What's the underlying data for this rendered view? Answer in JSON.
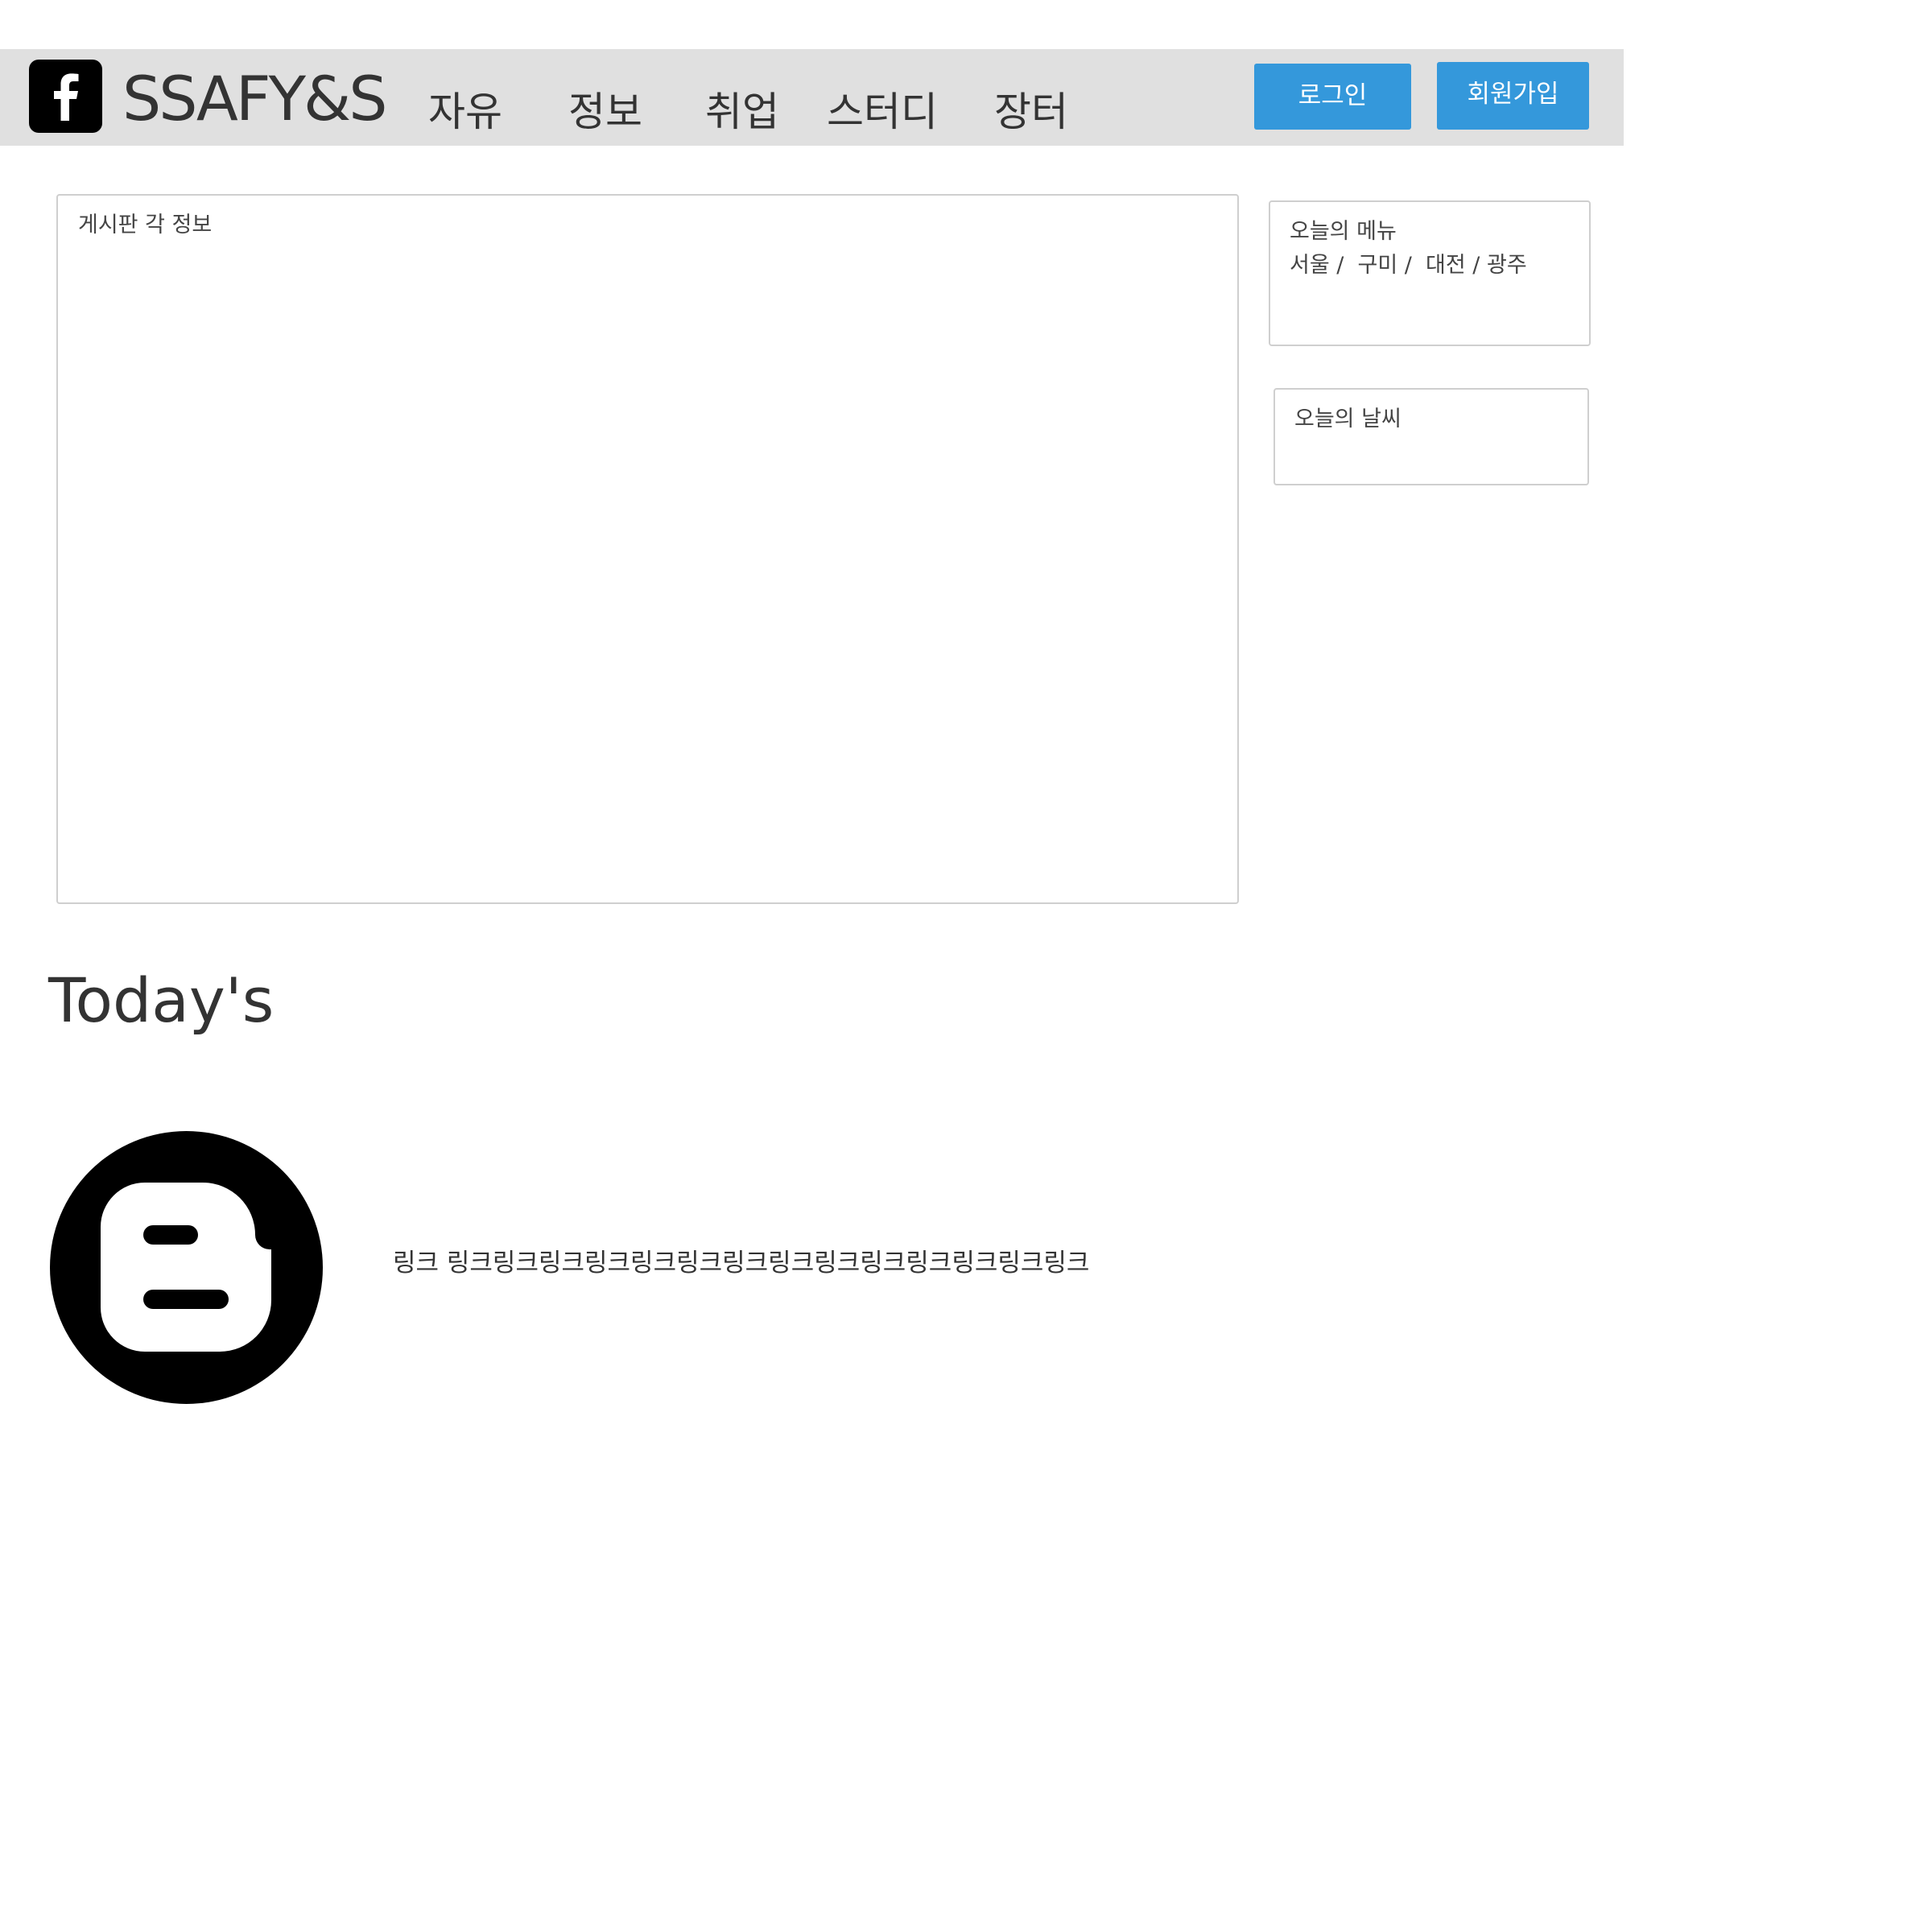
{
  "header": {
    "brand": "SSAFY&S",
    "nav": [
      "자유",
      "정보",
      "취업",
      "스터디",
      "장터"
    ],
    "login_label": "로그인",
    "signup_label": "회원가입",
    "background_color": "#e0e0e0",
    "button_color": "#3498db",
    "logo_icon": "facebook-icon"
  },
  "board": {
    "title": "게시판 각 정보"
  },
  "sidebar": {
    "menu": {
      "title": "오늘의 메뉴",
      "regions": "서울 /  구미 /  대전 / 광주"
    },
    "weather": {
      "title": "오늘의 날씨"
    }
  },
  "today": {
    "title": "Today's",
    "icon": "blogger-icon",
    "link_text": "링크 링크링크링크링크링크링크링크링크링크링크링크링크링크링크"
  }
}
